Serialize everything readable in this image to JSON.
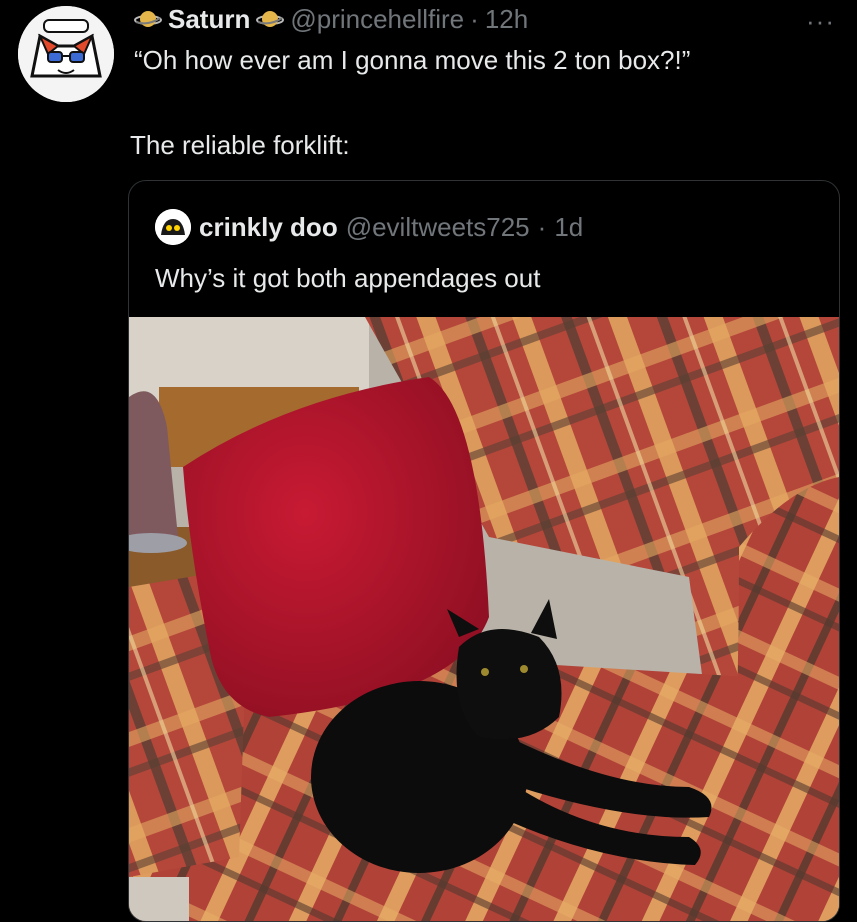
{
  "tweet": {
    "author_name": "Saturn",
    "author_handle": "@princehellfire",
    "separator": "·",
    "time": "12h",
    "more_label": "···",
    "text_line1": "“Oh how ever am I gonna move this 2 ton box?!”",
    "text_line2": "The reliable forklift:"
  },
  "quoted_tweet": {
    "author_name": "crinkly doo",
    "author_handle": "@eviltweets725",
    "separator": "·",
    "time": "1d",
    "text": "Why’s it got both appendages out"
  },
  "media": {
    "icon": "cat-on-couch-photo",
    "colors": {
      "pillow": "#b3122a",
      "couch_base": "#b5463a",
      "couch_stripe_light": "#e2a860",
      "couch_stripe_dark": "#5a3f33",
      "cat": "#0c0c0c"
    }
  }
}
